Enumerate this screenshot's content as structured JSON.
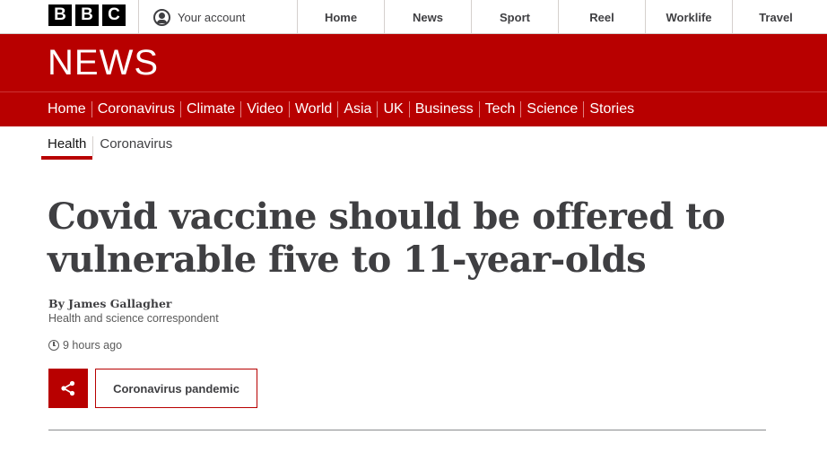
{
  "topbar": {
    "logo_letters": [
      "B",
      "B",
      "C"
    ],
    "account_label": "Your account",
    "nav": [
      "Home",
      "News",
      "Sport",
      "Reel",
      "Worklife",
      "Travel"
    ]
  },
  "banner": {
    "title": "NEWS",
    "nav": [
      "Home",
      "Coronavirus",
      "Climate",
      "Video",
      "World",
      "Asia",
      "UK",
      "Business",
      "Tech",
      "Science",
      "Stories"
    ],
    "color": "#b80000"
  },
  "subnav": {
    "items": [
      "Health",
      "Coronavirus"
    ],
    "active": "Health"
  },
  "article": {
    "headline": "Covid vaccine should be offered to vulnerable five to 11-year-olds",
    "author": "By James Gallagher",
    "role": "Health and science correspondent",
    "timestamp": "9 hours ago",
    "topic_label": "Coronavirus pandemic"
  }
}
